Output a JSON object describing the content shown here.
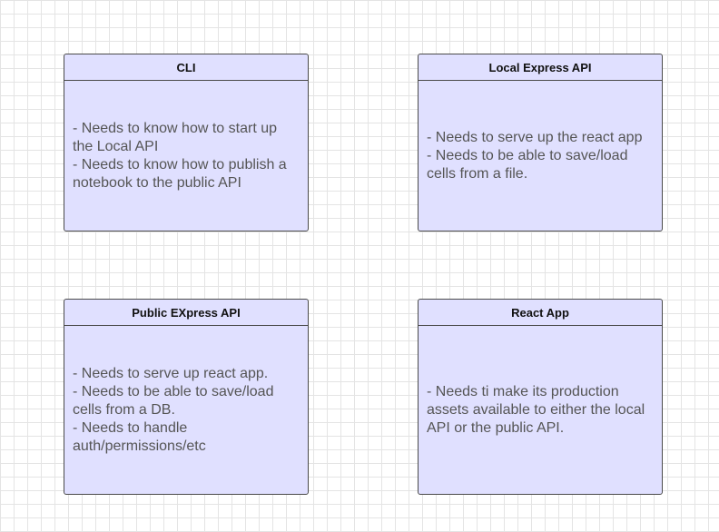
{
  "boxes": {
    "cli": {
      "title": "CLI",
      "items": [
        "- Needs to know how to start up the Local API",
        "- Needs to know how to publish a notebook to the public API"
      ]
    },
    "local_api": {
      "title": "Local Express API",
      "items": [
        "- Needs to serve up the react app",
        "- Needs to be able to save/load cells from a file."
      ]
    },
    "public_api": {
      "title": "Public EXpress API",
      "items": [
        "- Needs to serve up react app.",
        "- Needs to be able to save/load cells from a DB.",
        "- Needs to handle auth/permissions/etc"
      ]
    },
    "react_app": {
      "title": "React App",
      "items": [
        "- Needs ti make its production assets available to either the local API or the public API."
      ]
    }
  },
  "colors": {
    "box_fill": "#e0e0ff",
    "box_border": "#4a4a4a",
    "title_text": "#111111",
    "body_text": "#555555",
    "grid_line": "#e4e4e4",
    "background": "#ffffff"
  }
}
